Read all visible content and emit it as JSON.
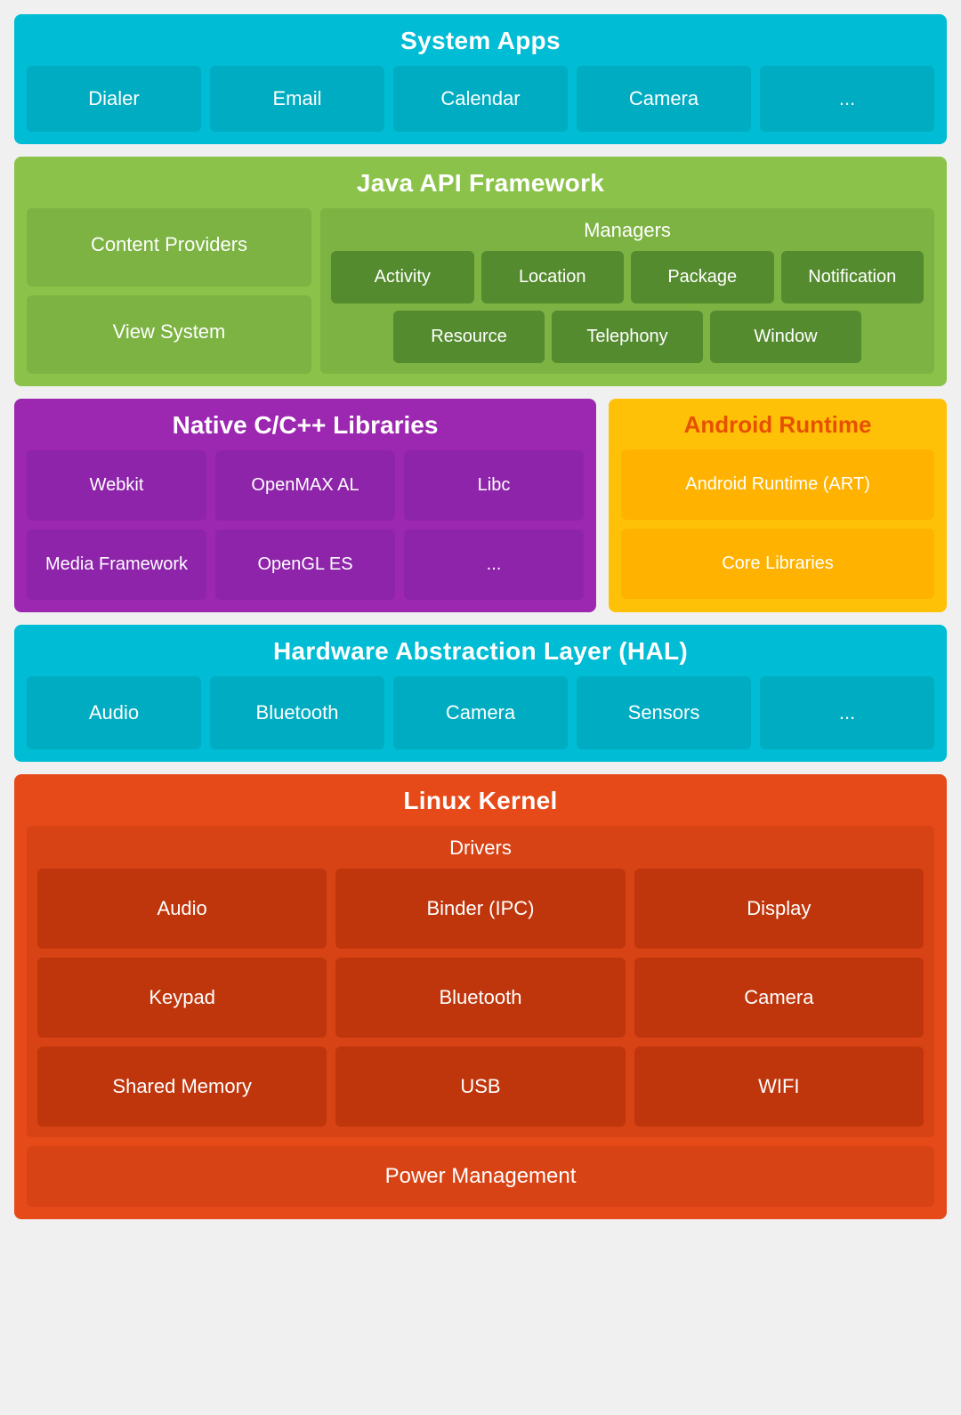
{
  "system_apps": {
    "title": "System Apps",
    "items": [
      "Dialer",
      "Email",
      "Calendar",
      "Camera",
      "..."
    ]
  },
  "java_api": {
    "title": "Java API Framework",
    "left_items": [
      "Content Providers",
      "View System"
    ],
    "managers": {
      "title": "Managers",
      "row1": [
        "Activity",
        "Location",
        "Package",
        "Notification"
      ],
      "row2": [
        "Resource",
        "Telephony",
        "Window"
      ]
    }
  },
  "native_libs": {
    "title": "Native C/C++ Libraries",
    "row1": [
      "Webkit",
      "OpenMAX AL",
      "Libc"
    ],
    "row2": [
      "Media Framework",
      "OpenGL ES",
      "..."
    ]
  },
  "android_runtime": {
    "title": "Android Runtime",
    "items": [
      "Android Runtime (ART)",
      "Core Libraries"
    ]
  },
  "hal": {
    "title": "Hardware Abstraction Layer (HAL)",
    "items": [
      "Audio",
      "Bluetooth",
      "Camera",
      "Sensors",
      "..."
    ]
  },
  "linux_kernel": {
    "title": "Linux Kernel",
    "drivers": {
      "title": "Drivers",
      "row1": [
        "Audio",
        "Binder (IPC)",
        "Display"
      ],
      "row2": [
        "Keypad",
        "Bluetooth",
        "Camera"
      ],
      "row3": [
        "Shared Memory",
        "USB",
        "WIFI"
      ]
    },
    "power_management": "Power Management"
  }
}
